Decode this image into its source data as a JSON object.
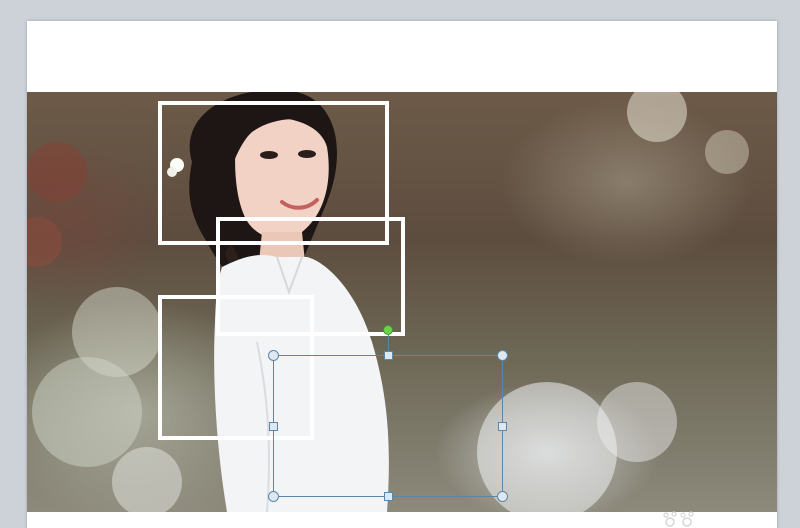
{
  "app": {
    "view": "slide-editor",
    "accent_color": "#5a86a8",
    "rotate_handle_color": "#6cd24a"
  },
  "slide": {
    "background": "#ffffff",
    "image": {
      "subject": "photo-woman-white-shirt",
      "icon": "photo-icon"
    },
    "frames": [
      {
        "name": "frame-1",
        "color": "#ffffff"
      },
      {
        "name": "frame-2",
        "color": "#ffffff"
      },
      {
        "name": "frame-3",
        "color": "#ffffff"
      }
    ],
    "selected_shape": {
      "name": "rectangle-shape",
      "state": "selected"
    }
  }
}
